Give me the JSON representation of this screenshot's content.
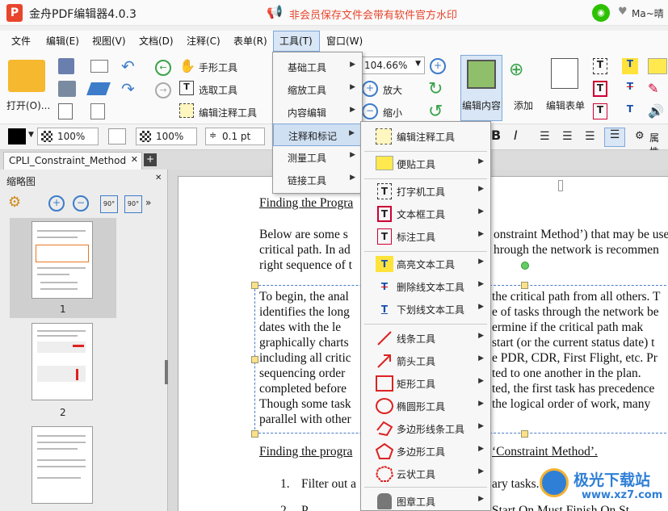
{
  "app": {
    "title": "金舟PDF编辑器4.0.3",
    "promo": "非会员保存文件会带有软件官方水印",
    "user": "Ma~晴"
  },
  "menu": [
    "文件",
    "编辑(E)",
    "视图(V)",
    "文档(D)",
    "注释(C)",
    "表单(R)",
    "工具(T)",
    "窗口(W)"
  ],
  "ribbon": {
    "open": "打开(O)...",
    "hand": "手形工具",
    "select": "选取工具",
    "edit_annot": "编辑注释工具",
    "zoom_value": "104.66%",
    "zoom_in": "放大",
    "zoom_out": "缩小",
    "edit_content": "编辑内容",
    "add": "添加",
    "edit_form": "编辑表单"
  },
  "format": {
    "opacity1": "100%",
    "opacity2": "100%",
    "stroke": "0.1 pt",
    "props": "属性"
  },
  "tab": {
    "name": "CPLI_Constraint_Method"
  },
  "sidebar": {
    "title": "缩略图",
    "pages": [
      "1",
      "2"
    ]
  },
  "tools_menu": [
    "基础工具",
    "缩放工具",
    "内容编辑",
    "注释和标记",
    "测量工具",
    "链接工具"
  ],
  "annot_menu": [
    "编辑注释工具",
    "便贴工具",
    "打字机工具",
    "文本框工具",
    "标注工具",
    "高亮文本工具",
    "删除线文本工具",
    "下划线文本工具",
    "线条工具",
    "箭头工具",
    "矩形工具",
    "椭圆形工具",
    "多边形线条工具",
    "多边形工具",
    "云状工具",
    "图章工具"
  ],
  "doc": {
    "h1": "Finding the Progra",
    "p1": [
      "Below are some s",
      "critical path. In ad",
      "right sequence of t"
    ],
    "p1r": [
      "onstraint Method’) that may be use",
      "hrough the network is recommen",
      ""
    ],
    "p2": [
      "To begin, the anal",
      "identifies the long",
      "dates with the le",
      "graphically charts",
      "including all critic",
      "sequencing order",
      "completed before",
      "Though some task",
      "parallel with other"
    ],
    "p2r": [
      "the critical path from all others. T",
      "e of tasks through the network be",
      "ermine if the critical path mak",
      "start (or the current status date) t",
      "e PDR, CDR, First Flight, etc. Pr",
      "ted to one another in the plan.",
      "ted, the first task has precedence",
      "the logical order of work, many",
      ""
    ],
    "h2": "Finding the progra",
    "h2r": "‘Constraint Method’.",
    "li1n": "1.",
    "li1": "Filter out a",
    "li1r": "ary tasks.",
    "li2n": "2.",
    "li2": "P",
    "li2r": "Start On Must Finish On St"
  },
  "watermark": {
    "name": "极光下载站",
    "url": "www.xz7.com"
  }
}
